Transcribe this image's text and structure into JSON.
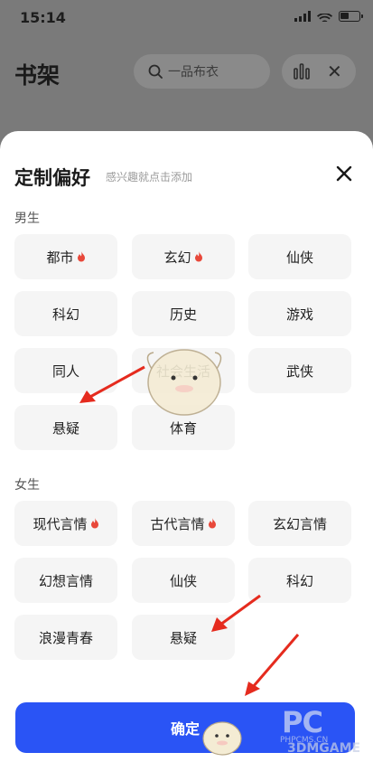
{
  "status_bar": {
    "time": "15:14"
  },
  "header": {
    "title": "书架",
    "search_placeholder": "一品布衣"
  },
  "sheet": {
    "title": "定制偏好",
    "subtitle": "感兴趣就点击添加",
    "male_label": "男生",
    "female_label": "女生",
    "male_chips": [
      {
        "label": "都市",
        "hot": true
      },
      {
        "label": "玄幻",
        "hot": true
      },
      {
        "label": "仙侠",
        "hot": false
      },
      {
        "label": "科幻",
        "hot": false
      },
      {
        "label": "历史",
        "hot": false
      },
      {
        "label": "游戏",
        "hot": false
      },
      {
        "label": "同人",
        "hot": false
      },
      {
        "label": "社会生活",
        "hot": false
      },
      {
        "label": "武侠",
        "hot": false
      },
      {
        "label": "悬疑",
        "hot": false
      },
      {
        "label": "体育",
        "hot": false
      }
    ],
    "female_chips": [
      {
        "label": "现代言情",
        "hot": true
      },
      {
        "label": "古代言情",
        "hot": true
      },
      {
        "label": "玄幻言情",
        "hot": false
      },
      {
        "label": "幻想言情",
        "hot": false
      },
      {
        "label": "仙侠",
        "hot": false
      },
      {
        "label": "科幻",
        "hot": false
      },
      {
        "label": "浪漫青春",
        "hot": false
      },
      {
        "label": "悬疑",
        "hot": false
      }
    ],
    "confirm_label": "确定"
  },
  "watermark": {
    "brand": "PC",
    "site": "PHPCMS.CN",
    "logo": "3DMGAME"
  },
  "colors": {
    "accent": "#2a54f5",
    "hot": "#e8483a",
    "arrow": "#e52b1e"
  }
}
